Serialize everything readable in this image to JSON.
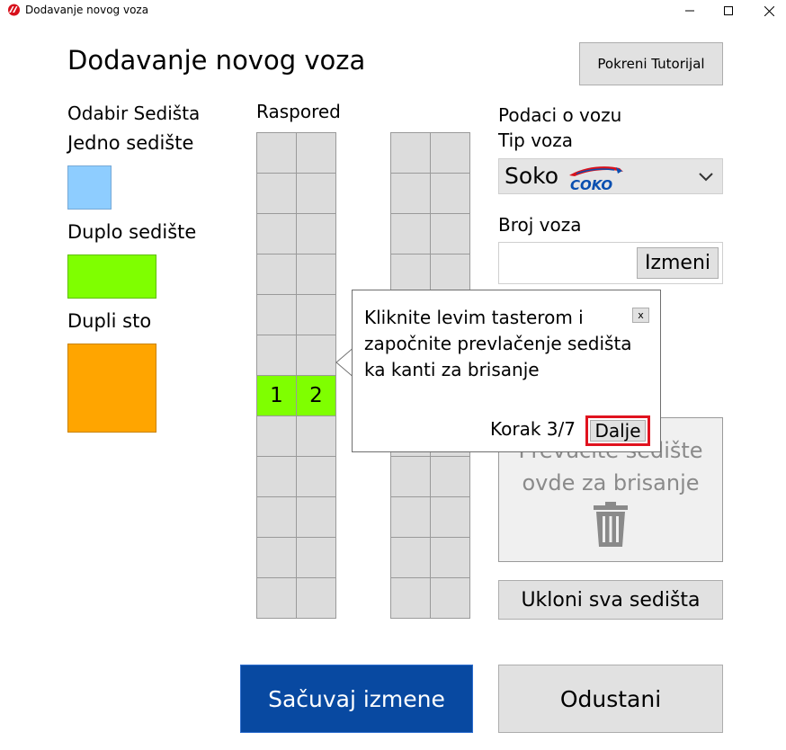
{
  "window": {
    "title": "Dodavanje novog voza",
    "icon": "app-logo-icon",
    "controls": [
      "minimize-icon",
      "maximize-icon",
      "close-icon"
    ]
  },
  "header": {
    "title": "Dodavanje novog voza",
    "tutorial_button": "Pokreni Tutorijal"
  },
  "seat_selection": {
    "title": "Odabir Sedišta",
    "single": "Jedno sedište",
    "double": "Duplo sedište",
    "table": "Dupli sto",
    "colors": {
      "single": "#8ecdff",
      "double": "#7fff00",
      "table": "#ffa500"
    }
  },
  "layout": {
    "title": "Raspored",
    "rows": 12,
    "columns_per_block": 2,
    "placed_seats": [
      {
        "row": 6,
        "labels": [
          "1",
          "2"
        ],
        "color": "#7fff00"
      }
    ]
  },
  "train": {
    "section_title": "Podaci o vozu",
    "type_label": "Tip voza",
    "type_value": "Soko",
    "type_logo_text": "COKO",
    "number_label": "Broj voza",
    "number_value": "",
    "edit_button": "Izmeni"
  },
  "trash": {
    "line1": "Prevucite sedište",
    "line2": "ovde za brisanje",
    "icon": "trash-icon"
  },
  "remove_all_button": "Ukloni sva sedišta",
  "save_button": "Sačuvaj izmene",
  "cancel_button": "Odustani",
  "tooltip": {
    "text": "Kliknite levim tasterom i započnite prevlačenje sedišta ka kanti za brisanje",
    "close": "x",
    "step": "Korak 3/7",
    "next": "Dalje",
    "highlight_color": "#e0131f"
  },
  "colors": {
    "primary": "#0849a1",
    "button_gray": "#e1e1e1",
    "cell_gray": "#dcdcdc"
  }
}
